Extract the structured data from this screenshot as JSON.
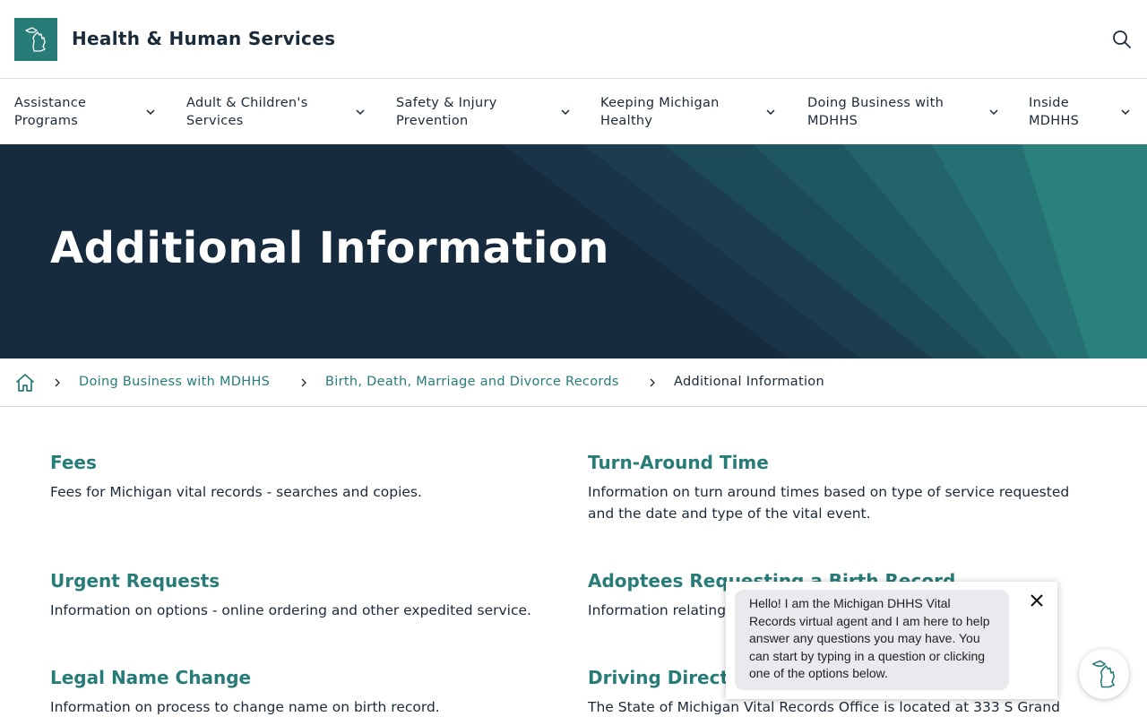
{
  "header": {
    "site_title": "Health & Human Services",
    "logo_icon": "michigan-state-icon",
    "search_icon": "search-icon",
    "brand_color": "#277c78"
  },
  "nav": {
    "items": [
      {
        "label": "Assistance\nPrograms"
      },
      {
        "label": "Adult & Children's\nServices"
      },
      {
        "label": "Safety & Injury\nPrevention"
      },
      {
        "label": "Keeping Michigan\nHealthy"
      },
      {
        "label": "Doing Business with\nMDHHS"
      },
      {
        "label": "Inside\nMDHHS"
      }
    ]
  },
  "hero": {
    "title": "Additional Information",
    "background_color": "#172b3f"
  },
  "breadcrumb": {
    "home_icon": "home-icon",
    "items": [
      {
        "label": "Doing Business with MDHHS"
      },
      {
        "label": "Birth, Death, Marriage and Divorce Records"
      }
    ],
    "current": "Additional Information"
  },
  "cards": [
    {
      "title": "Fees",
      "description": "Fees for Michigan vital records - searches and copies."
    },
    {
      "title": "Turn-Around Time",
      "description": "Information on turn around times based on type of service requested and the date and type of the vital event."
    },
    {
      "title": "Urgent Requests",
      "description": "Information on options - online ordering and other expedited service."
    },
    {
      "title": "Adoptees Requesting a Birth Record",
      "description": "Information relating"
    },
    {
      "title": "Legal Name Change",
      "description": "Information on process to change name on birth record."
    },
    {
      "title": "Driving Directi",
      "description": "The State of Michigan Vital Records Office is located at 333 S Grand"
    }
  ],
  "chat": {
    "message": "Hello! I am the Michigan DHHS Vital Records virtual agent and I am here to help answer any questions you may have. You can start by typing in a question or clicking one of the options below.",
    "close_icon": "close-icon",
    "launcher_icon": "michigan-state-icon"
  }
}
